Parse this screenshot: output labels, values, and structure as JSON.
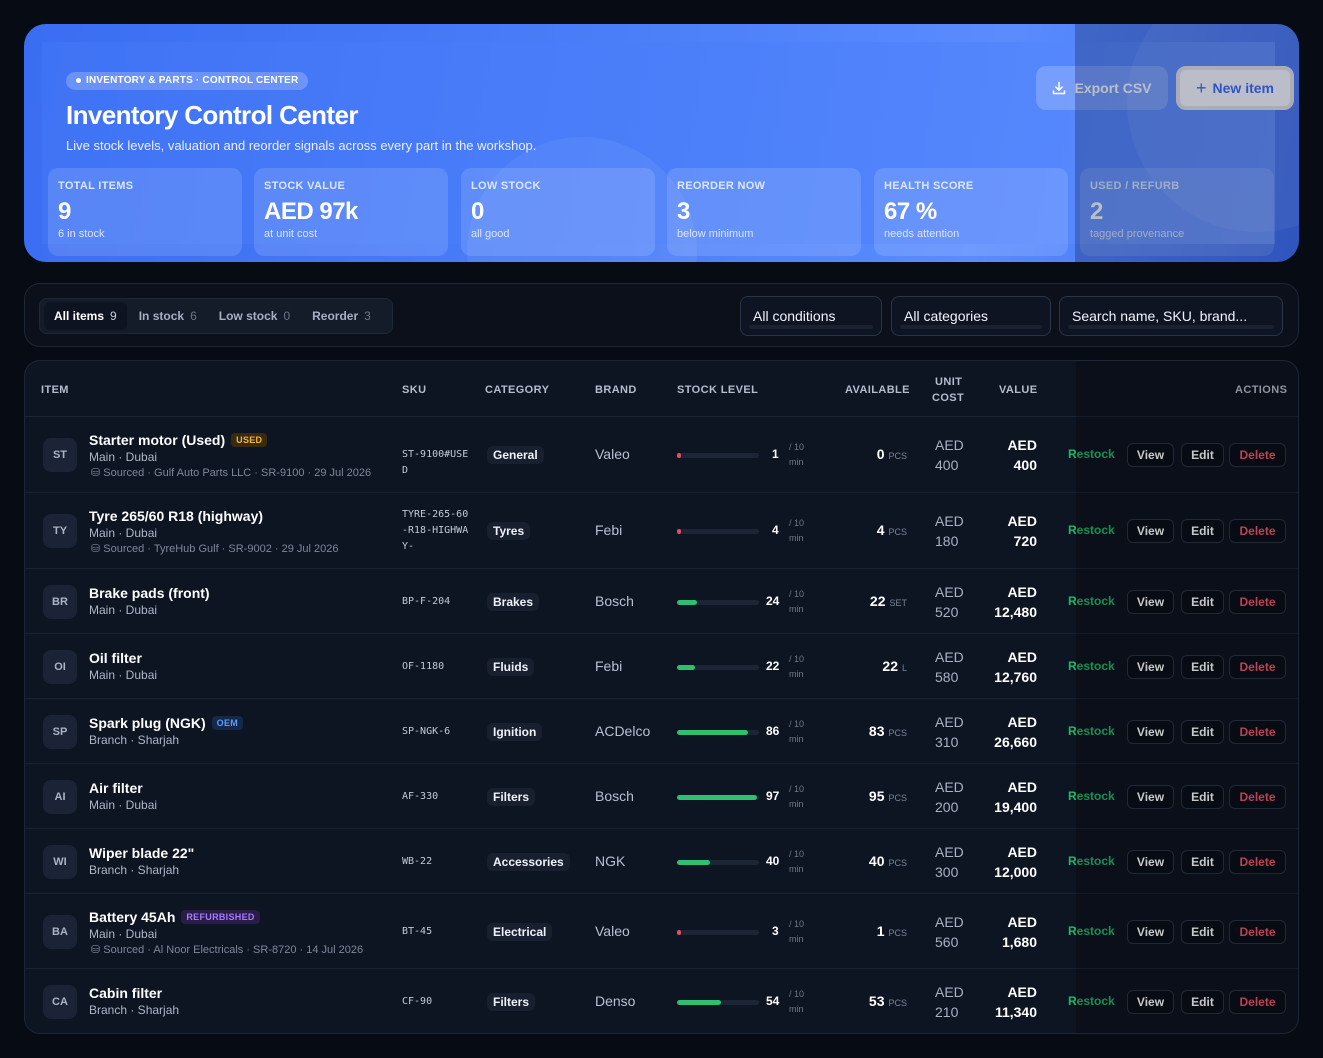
{
  "hero": {
    "badge": "INVENTORY & PARTS · CONTROL CENTER",
    "title": "Inventory Control Center",
    "subtitle": "Live stock levels, valuation and reorder signals across every part in the workshop.",
    "export_label": "Export CSV",
    "new_item_label": "New item",
    "stats": [
      {
        "label": "TOTAL ITEMS",
        "value": "9",
        "hint": "6 in stock"
      },
      {
        "label": "STOCK VALUE",
        "value": "AED 97k",
        "hint": "at unit cost"
      },
      {
        "label": "LOW STOCK",
        "value": "0",
        "hint": "all good"
      },
      {
        "label": "REORDER NOW",
        "value": "3",
        "hint": "below minimum"
      },
      {
        "label": "HEALTH SCORE",
        "value": "67 %",
        "hint": "needs attention"
      },
      {
        "label": "USED / REFURB",
        "value": "2",
        "hint": "tagged provenance"
      }
    ]
  },
  "filters": {
    "tabs": [
      {
        "label": "All items",
        "count": "9"
      },
      {
        "label": "In stock",
        "count": "6"
      },
      {
        "label": "Low stock",
        "count": "0"
      },
      {
        "label": "Reorder",
        "count": "3"
      }
    ],
    "condition": "All conditions",
    "category": "All categories",
    "search_placeholder": "Search name, SKU, brand..."
  },
  "table": {
    "headers": {
      "item": "ITEM",
      "sku": "SKU",
      "category": "CATEGORY",
      "brand": "BRAND",
      "stock_level": "STOCK LEVEL",
      "available": "AVAILABLE",
      "unit_cost_1": "UNIT",
      "unit_cost_2": "COST",
      "value": "VALUE",
      "actions": "ACTIONS"
    },
    "action_labels": {
      "restock": "Restock",
      "view": "View",
      "edit": "Edit",
      "delete": "Delete"
    },
    "rows": [
      {
        "initials": "ST",
        "name": "Starter motor (Used)",
        "tag": "USED",
        "tag_kind": "used",
        "location": "Main · Dubai",
        "source": "Sourced · Gulf Auto Parts LLC · SR-9100 · 29 Jul 2026",
        "sku": "ST-9100#USED",
        "category": "General",
        "brand": "Valeo",
        "qty": "1",
        "level": 0.01,
        "min": "/ 10",
        "min2": "min",
        "available": "0",
        "unit": "PCS",
        "cost_cur": "AED",
        "cost": "400",
        "value_cur": "AED",
        "value": "400"
      },
      {
        "initials": "TY",
        "name": "Tyre 265/60 R18 (highway)",
        "tag": "",
        "tag_kind": "",
        "location": "Main · Dubai",
        "source": "Sourced · TyreHub Gulf · SR-9002 · 29 Jul 2026",
        "sku": "TYRE-265-60-R18-HIGHWAY-",
        "category": "Tyres",
        "brand": "Febi",
        "qty": "4",
        "level": 0.04,
        "min": "/ 10",
        "min2": "min",
        "available": "4",
        "unit": "PCS",
        "cost_cur": "AED",
        "cost": "180",
        "value_cur": "AED",
        "value": "720"
      },
      {
        "initials": "BR",
        "name": "Brake pads (front)",
        "tag": "",
        "tag_kind": "",
        "location": "Main · Dubai",
        "source": "",
        "sku": "BP-F-204",
        "category": "Brakes",
        "brand": "Bosch",
        "qty": "24",
        "level": 0.24,
        "min": "/ 10",
        "min2": "min",
        "available": "22",
        "unit": "SET",
        "cost_cur": "AED",
        "cost": "520",
        "value_cur": "AED",
        "value": "12,480"
      },
      {
        "initials": "OI",
        "name": "Oil filter",
        "tag": "",
        "tag_kind": "",
        "location": "Main · Dubai",
        "source": "",
        "sku": "OF-1180",
        "category": "Fluids",
        "brand": "Febi",
        "qty": "22",
        "level": 0.22,
        "min": "/ 10",
        "min2": "min",
        "available": "22",
        "unit": "L",
        "cost_cur": "AED",
        "cost": "580",
        "value_cur": "AED",
        "value": "12,760"
      },
      {
        "initials": "SP",
        "name": "Spark plug (NGK)",
        "tag": "OEM",
        "tag_kind": "oem",
        "location": "Branch · Sharjah",
        "source": "",
        "sku": "SP-NGK-6",
        "category": "Ignition",
        "brand": "ACDelco",
        "qty": "86",
        "level": 0.86,
        "min": "/ 10",
        "min2": "min",
        "available": "83",
        "unit": "PCS",
        "cost_cur": "AED",
        "cost": "310",
        "value_cur": "AED",
        "value": "26,660"
      },
      {
        "initials": "AI",
        "name": "Air filter",
        "tag": "",
        "tag_kind": "",
        "location": "Main · Dubai",
        "source": "",
        "sku": "AF-330",
        "category": "Filters",
        "brand": "Bosch",
        "qty": "97",
        "level": 0.97,
        "min": "/ 10",
        "min2": "min",
        "available": "95",
        "unit": "PCS",
        "cost_cur": "AED",
        "cost": "200",
        "value_cur": "AED",
        "value": "19,400"
      },
      {
        "initials": "WI",
        "name": "Wiper blade 22\"",
        "tag": "",
        "tag_kind": "",
        "location": "Branch · Sharjah",
        "source": "",
        "sku": "WB-22",
        "category": "Accessories",
        "brand": "NGK",
        "qty": "40",
        "level": 0.4,
        "min": "/ 10",
        "min2": "min",
        "available": "40",
        "unit": "PCS",
        "cost_cur": "AED",
        "cost": "300",
        "value_cur": "AED",
        "value": "12,000"
      },
      {
        "initials": "BA",
        "name": "Battery 45Ah",
        "tag": "REFURBISHED",
        "tag_kind": "refurb",
        "location": "Main · Dubai",
        "source": "Sourced · Al Noor Electricals · SR-8720 · 14 Jul 2026",
        "sku": "BT-45",
        "category": "Electrical",
        "brand": "Valeo",
        "qty": "3",
        "level": 0.03,
        "min": "/ 10",
        "min2": "min",
        "available": "1",
        "unit": "PCS",
        "cost_cur": "AED",
        "cost": "560",
        "value_cur": "AED",
        "value": "1,680"
      },
      {
        "initials": "CA",
        "name": "Cabin filter",
        "tag": "",
        "tag_kind": "",
        "location": "Branch · Sharjah",
        "source": "",
        "sku": "CF-90",
        "category": "Filters",
        "brand": "Denso",
        "qty": "54",
        "level": 0.54,
        "min": "/ 10",
        "min2": "min",
        "available": "53",
        "unit": "PCS",
        "cost_cur": "AED",
        "cost": "210",
        "value_cur": "AED",
        "value": "11,340"
      }
    ]
  }
}
